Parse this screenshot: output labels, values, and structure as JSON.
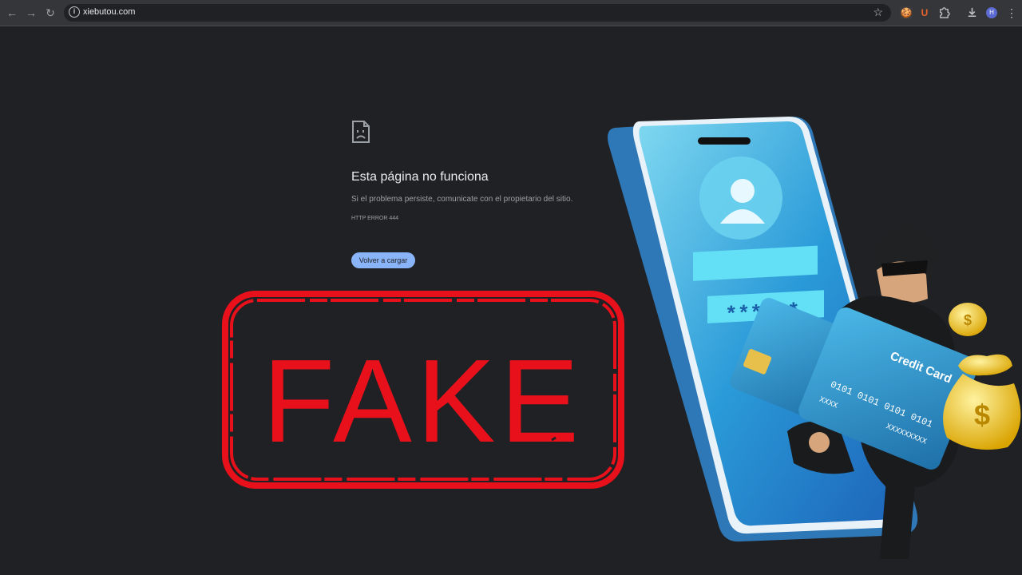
{
  "browser": {
    "url": "xiebutou.com",
    "nav": {
      "back": "←",
      "forward": "→",
      "reload": "↻"
    },
    "icons": [
      "info-icon",
      "star-icon",
      "extension-icon",
      "downloads-icon",
      "menu-icon"
    ],
    "extensions": [
      {
        "name": "extension-1",
        "glyph": "🍪",
        "color": "#f5a623"
      },
      {
        "name": "extension-2",
        "glyph": "U",
        "color": "#e8622c"
      }
    ],
    "profile_initial": "H",
    "star_glyph": "☆",
    "menu_glyph": "⋮"
  },
  "error": {
    "title": "Esta página no funciona",
    "description": "Si el problema persiste, comunicate con el propietario del sitio.",
    "code": "HTTP ERROR 444",
    "reload_label": "Volver a cargar"
  },
  "overlay": {
    "stamp_text": "FAKE",
    "stamp_color": "#e8101a",
    "card_title": "Credit Card",
    "card_number": "0101 0101 0101 0101",
    "card_left": "XXXX",
    "card_right": "XXXXXXXXX",
    "password_mask": "******",
    "coin_symbol": "$"
  }
}
